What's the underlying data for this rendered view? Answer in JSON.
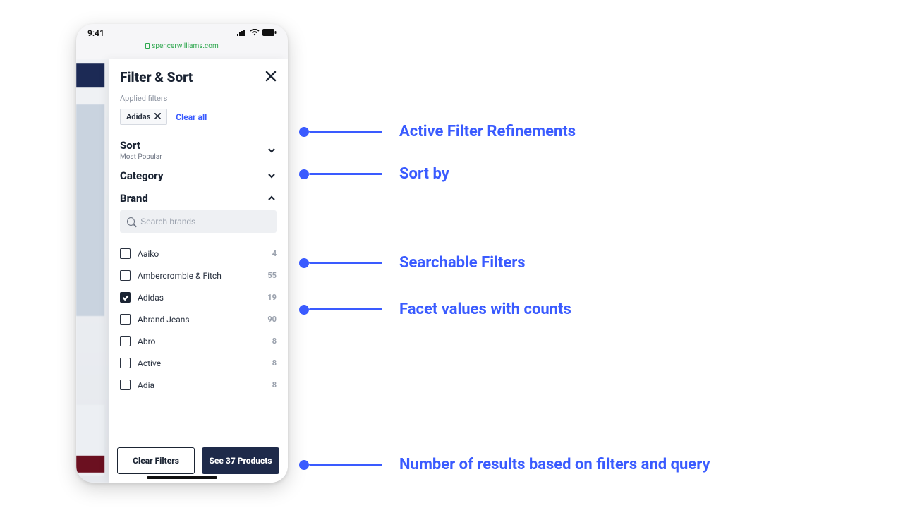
{
  "statusbar": {
    "time": "9:41"
  },
  "urlbar": {
    "domain": "spencerwilliams.com"
  },
  "panel": {
    "title": "Filter & Sort",
    "applied_label": "Applied filters",
    "chips": [
      {
        "label": "Adidas"
      }
    ],
    "clear_all": "Clear all"
  },
  "sort": {
    "heading": "Sort",
    "selected": "Most Popular"
  },
  "category": {
    "heading": "Category"
  },
  "brand": {
    "heading": "Brand",
    "search_placeholder": "Search brands",
    "facets": [
      {
        "label": "Aaiko",
        "count": 4,
        "checked": false
      },
      {
        "label": "Ambercrombie & Fitch",
        "count": 55,
        "checked": false
      },
      {
        "label": "Adidas",
        "count": 19,
        "checked": true
      },
      {
        "label": "Abrand Jeans",
        "count": 90,
        "checked": false
      },
      {
        "label": "Abro",
        "count": 8,
        "checked": false
      },
      {
        "label": "Active",
        "count": 8,
        "checked": false
      },
      {
        "label": "Adia",
        "count": 8,
        "checked": false
      }
    ]
  },
  "footer": {
    "clear": "Clear Filters",
    "see": "See 37 Products"
  },
  "annotations": {
    "a1": "Active Filter Refinements",
    "a2": "Sort by",
    "a3": "Searchable Filters",
    "a4": "Facet values with counts",
    "a5": "Number of results based on filters and query"
  }
}
